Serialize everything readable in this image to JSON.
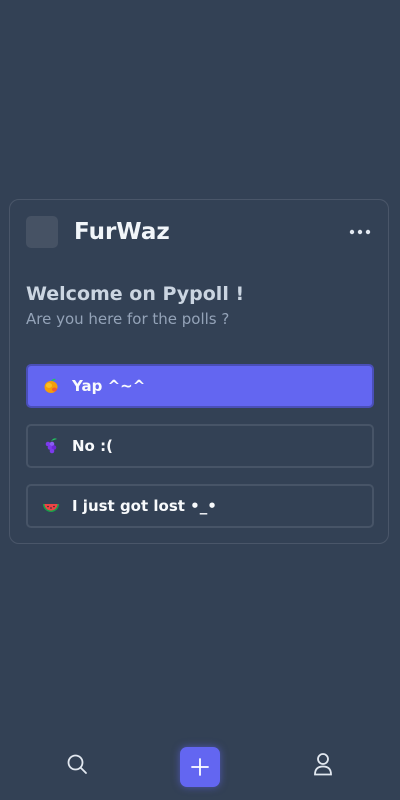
{
  "colors": {
    "background": "#334155",
    "accent": "#6366f1",
    "card_border": "#4a5669",
    "title_text": "#cbd5e1",
    "subtitle_text": "#94a3b8"
  },
  "poll": {
    "author": "FurWaz",
    "title": "Welcome on Pypoll !",
    "subtitle": "Are you here for the polls ?",
    "more_icon": "more-horizontal-icon",
    "options": [
      {
        "emoji_icon": "mango-icon",
        "label": "Yap ^~^",
        "selected": true
      },
      {
        "emoji_icon": "grapes-icon",
        "label": "No :(",
        "selected": false
      },
      {
        "emoji_icon": "watermelon-icon",
        "label": "I just got lost •_•",
        "selected": false
      }
    ]
  },
  "bottom_nav": {
    "items": [
      {
        "icon": "search-icon"
      },
      {
        "icon": "plus-icon",
        "active": true
      },
      {
        "icon": "user-icon"
      }
    ]
  }
}
